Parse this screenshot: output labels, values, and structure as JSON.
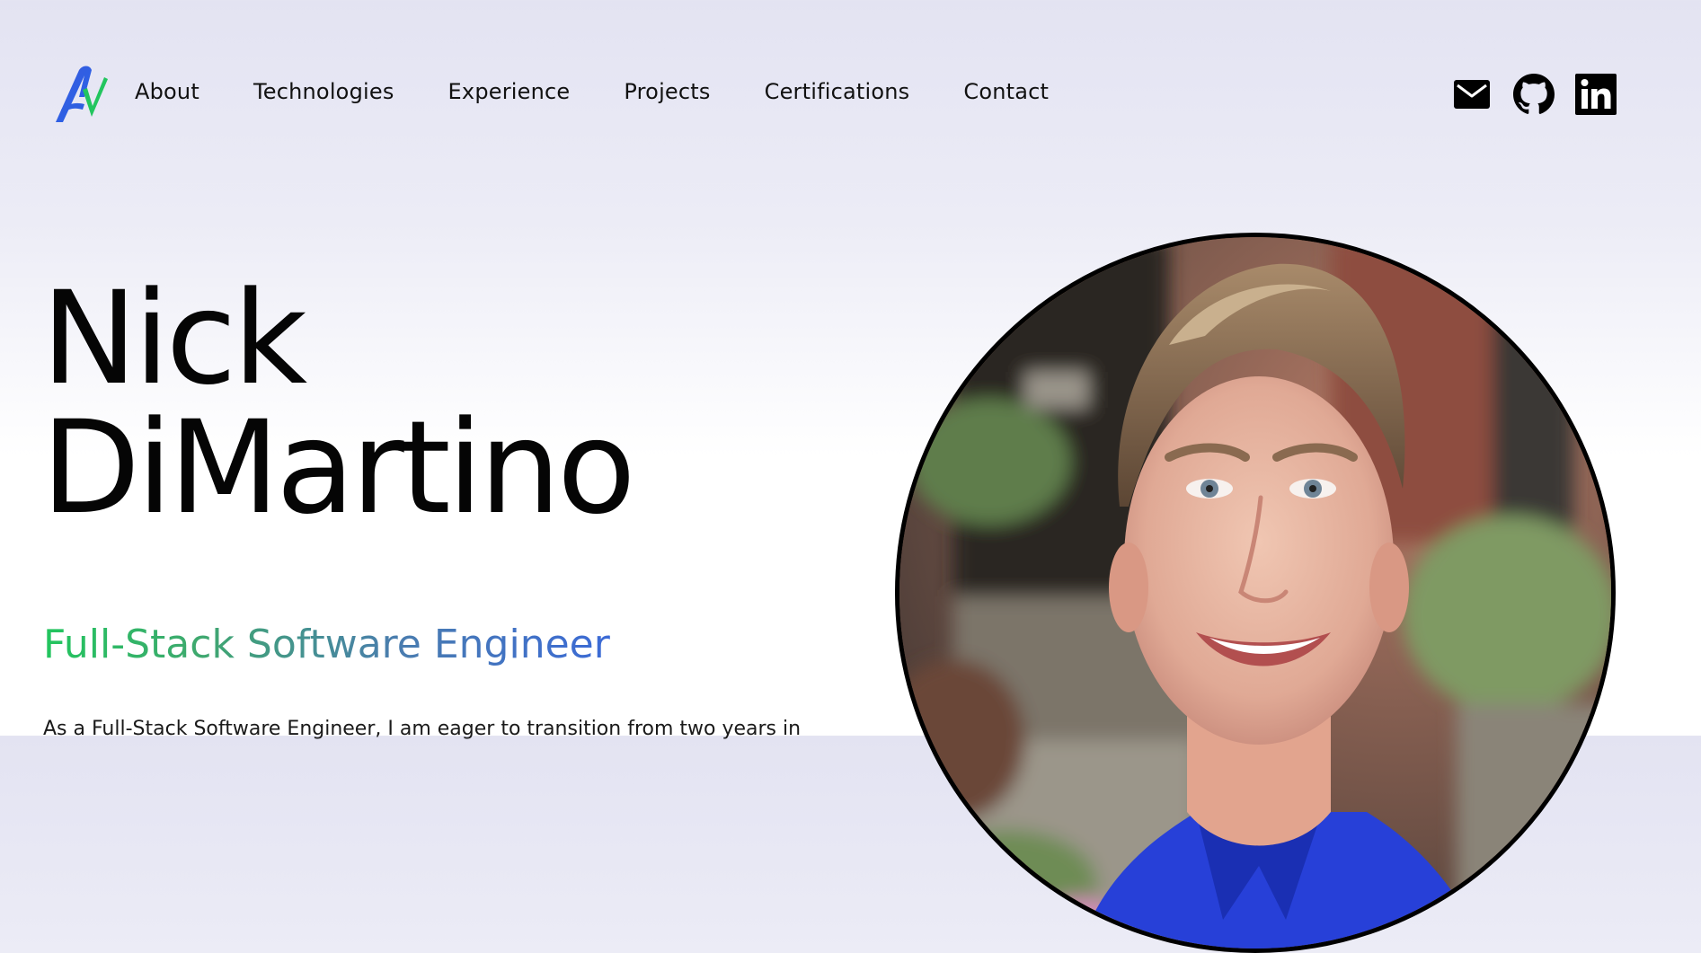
{
  "nav": {
    "logo_name": "logo-icon",
    "links": [
      {
        "label": "About"
      },
      {
        "label": "Technologies"
      },
      {
        "label": "Experience"
      },
      {
        "label": "Projects"
      },
      {
        "label": "Certifications"
      },
      {
        "label": "Contact"
      }
    ],
    "socials": [
      {
        "icon": "mail-icon"
      },
      {
        "icon": "github-icon"
      },
      {
        "icon": "linkedin-icon"
      }
    ]
  },
  "hero": {
    "first_name": "Nick",
    "last_name": "DiMartino",
    "role": "Full-Stack Software Engineer",
    "intro": "As a Full-Stack Software Engineer, I am eager to transition from two years in"
  },
  "colors": {
    "accent_green": "#22c55e",
    "accent_blue": "#3b6ad6",
    "text": "#0a0a0a"
  },
  "portrait": {
    "icon": "profile-photo"
  }
}
